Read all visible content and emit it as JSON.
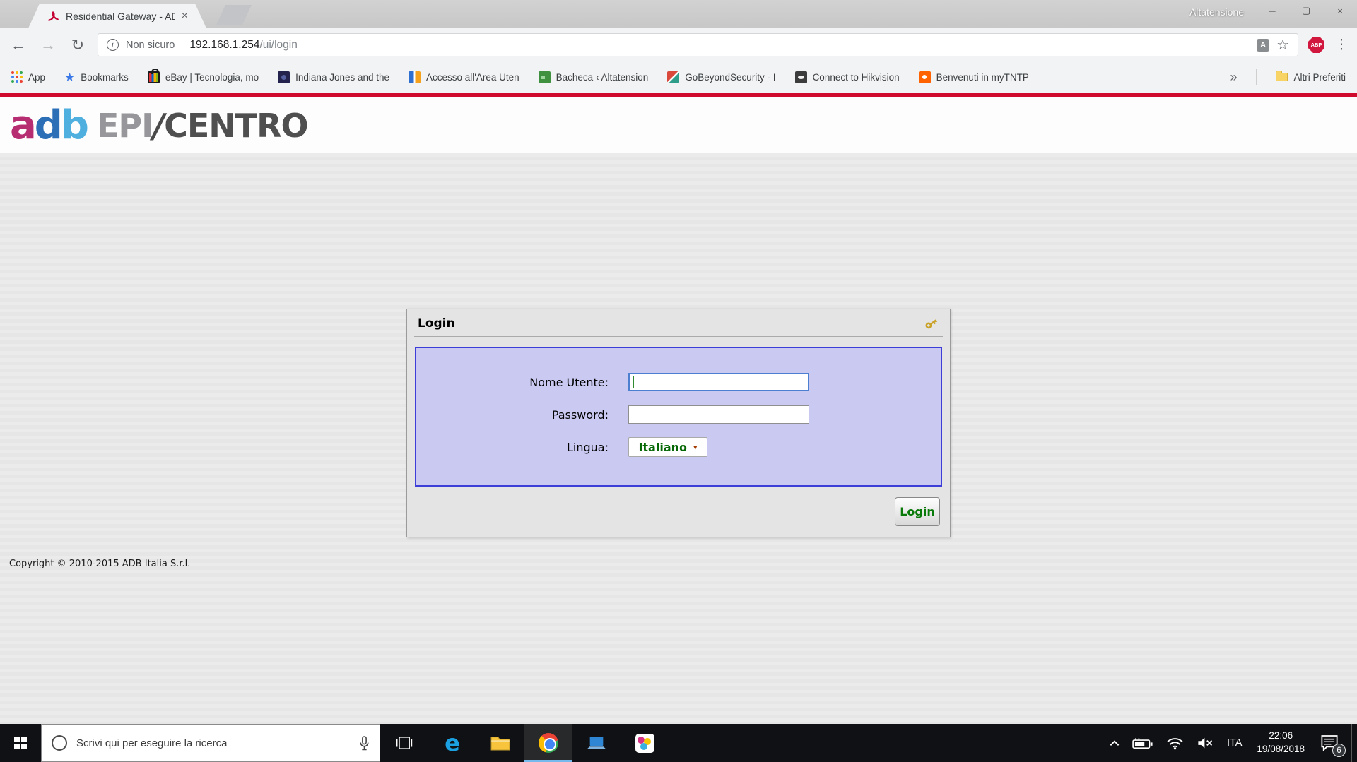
{
  "window": {
    "tab_title": "Residential Gateway - AD",
    "profile_name": "Altatensione",
    "controls": {
      "minimize": "─",
      "maximize": "▢",
      "close": "×"
    }
  },
  "toolbar": {
    "security_label": "Non sicuro",
    "url_host": "192.168.1.254",
    "url_path": "/ui/login",
    "abp_label": "ABP"
  },
  "icons": {
    "back": "←",
    "forward": "→",
    "reload": "↻",
    "info": "i",
    "star": "☆",
    "menu": "⋮",
    "tab_close": "×",
    "overflow": "»",
    "dropdown_arrow": "▾",
    "translate": "A"
  },
  "bookmarks": {
    "items": [
      {
        "label": "App",
        "icon": "apps-grid-icon"
      },
      {
        "label": "Bookmarks",
        "icon": "star-icon"
      },
      {
        "label": "eBay | Tecnologia, mo",
        "icon": "ebay-bag-icon"
      },
      {
        "label": "Indiana Jones and the",
        "icon": "movie-icon"
      },
      {
        "label": "Accesso all'Area Uten",
        "icon": "area-utenti-icon"
      },
      {
        "label": "Bacheca ‹ Altatension",
        "icon": "bacheca-icon"
      },
      {
        "label": "GoBeyondSecurity - I",
        "icon": "security-icon"
      },
      {
        "label": "Connect to Hikvision",
        "icon": "camera-icon"
      },
      {
        "label": "Benvenuti in myTNTP",
        "icon": "tnt-icon"
      }
    ],
    "other_label": "Altri Preferiti"
  },
  "page": {
    "logo": {
      "a": "a",
      "d": "d",
      "b": "b",
      "epi": "EPI",
      "slash": "/",
      "centro": "CENTRO"
    },
    "login_box": {
      "title": "Login",
      "username_label": "Nome Utente:",
      "password_label": "Password:",
      "language_label": "Lingua:",
      "language_value": "Italiano",
      "submit_label": "Login"
    },
    "copyright": "Copyright © 2010-2015 ADB Italia S.r.l."
  },
  "taskbar": {
    "search_placeholder": "Scrivi qui per eseguire la ricerca",
    "language_indicator": "ITA",
    "time": "22:06",
    "date": "19/08/2018",
    "notification_count": "6"
  },
  "colors": {
    "accent_red": "#cf0a2c",
    "panel_purple": "#c9c9f2",
    "panel_border_blue": "#3d3dd8",
    "login_green": "#0a7a0a"
  }
}
